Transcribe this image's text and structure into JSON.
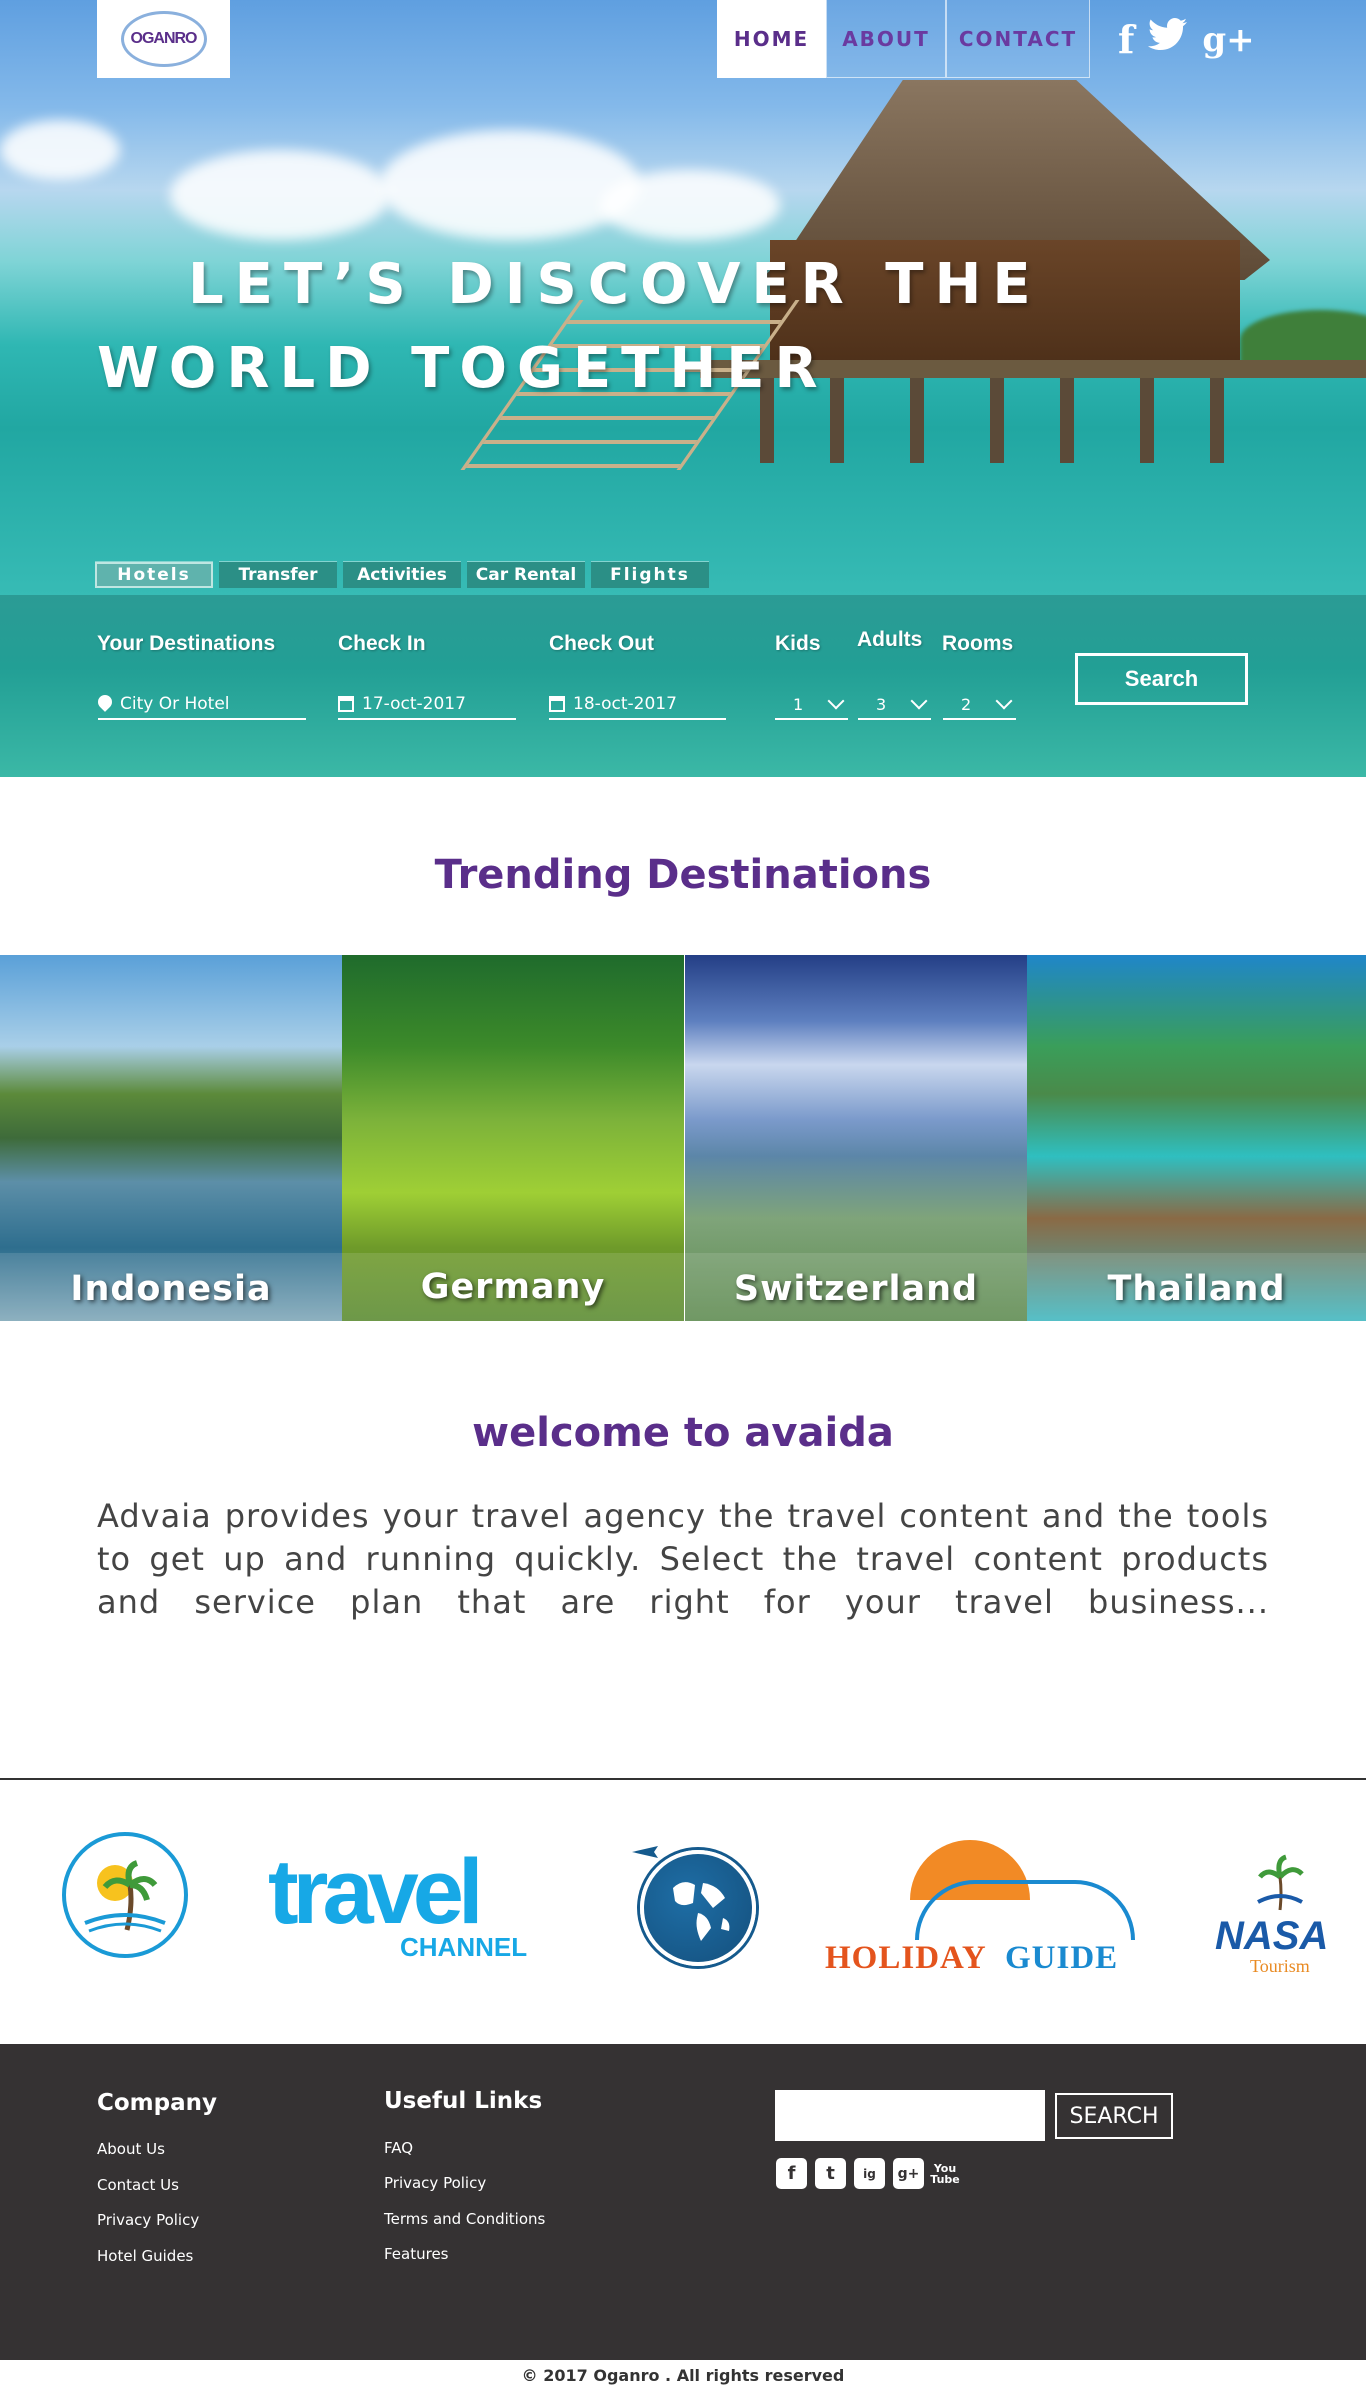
{
  "brand": {
    "logo_text": "OGANRO"
  },
  "nav": [
    {
      "label": "HOME"
    },
    {
      "label": "ABOUT"
    },
    {
      "label": "CONTACT"
    }
  ],
  "social_header": {
    "facebook": "f",
    "twitter": "🐦",
    "googleplus": "g+"
  },
  "hero": {
    "line1": "LET’S DISCOVER THE",
    "line2": "WORLD TOGETHER"
  },
  "tabs": [
    "Hotels",
    "Transfer",
    "Activities",
    "Car Rental",
    "Flights"
  ],
  "search": {
    "destination_label": "Your Destinations",
    "destination_placeholder": "City Or Hotel",
    "checkin_label": "Check In",
    "checkin_value": "17-oct-2017",
    "checkout_label": "Check Out",
    "checkout_value": "18-oct-2017",
    "kids_label": "Kids",
    "kids_value": "1",
    "adults_label": "Adults",
    "adults_value": "3",
    "rooms_label": "Rooms",
    "rooms_value": "2",
    "button": "Search"
  },
  "trending": {
    "title": "Trending Destinations",
    "items": [
      "Indonesia",
      "Germany",
      "Switzerland",
      "Thailand"
    ]
  },
  "welcome": {
    "title": "welcome to avaida",
    "text": "Advaia provides your travel agency the travel content and the tools to get up and running quickly. Select the travel content products and service plan that are right for your travel business..."
  },
  "partners": {
    "travel": "travel",
    "travel_sub": "CHANNEL",
    "holiday1": "HOLIDAY",
    "holiday2": "GUIDE",
    "nasa": "NASA",
    "nasa_sub": "Tourism"
  },
  "footer": {
    "company_title": "Company",
    "company_links": [
      "About Us",
      "Contact Us",
      "Privacy Policy",
      "Hotel Guides"
    ],
    "useful_title": "Useful Links",
    "useful_links": [
      "FAQ",
      "Privacy Policy",
      "Terms and Conditions",
      "Features"
    ],
    "search_button": "SEARCH",
    "socials": [
      "f",
      "t",
      "ig",
      "g+",
      "You Tube"
    ],
    "copyright": "© 2017 Oganro . All rights reserved"
  },
  "colors": {
    "brand_purple": "#5a2e8a",
    "teal": "#229f95",
    "footer_bg": "#353233"
  }
}
